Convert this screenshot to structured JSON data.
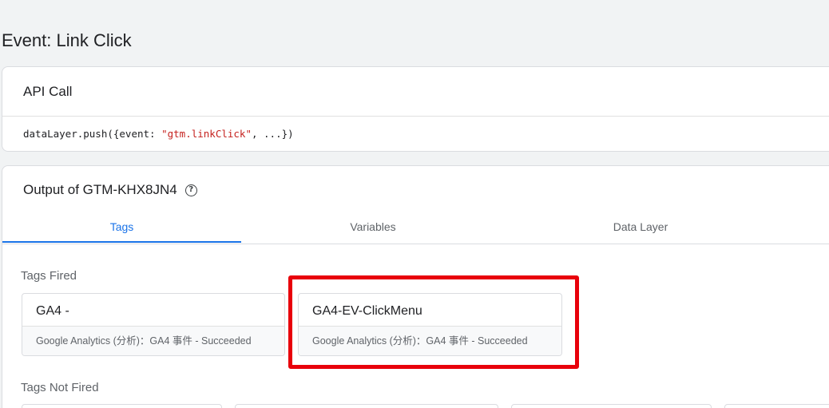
{
  "event": {
    "title": "Event: Link Click"
  },
  "api_call": {
    "title": "API Call",
    "code_prefix": "dataLayer.push({event: ",
    "code_string": "\"gtm.linkClick\"",
    "code_suffix": ", ...})"
  },
  "output": {
    "title": "Output of GTM-KHX8JN4",
    "help_icon": "help-circle-icon",
    "tabs": [
      {
        "label": "Tags",
        "active": true
      },
      {
        "label": "Variables",
        "active": false
      },
      {
        "label": "Data Layer",
        "active": false
      }
    ],
    "tags_fired": {
      "label": "Tags Fired",
      "items": [
        {
          "name": "GA4 -",
          "status": "Google Analytics (分析)：GA4 事件 - Succeeded"
        },
        {
          "name": "GA4-EV-ClickMenu",
          "status": "Google Analytics (分析)：GA4 事件 - Succeeded"
        }
      ]
    },
    "tags_not_fired": {
      "label": "Tags Not Fired"
    }
  },
  "colors": {
    "accent": "#1a73e8",
    "highlight": "#e8000b"
  }
}
